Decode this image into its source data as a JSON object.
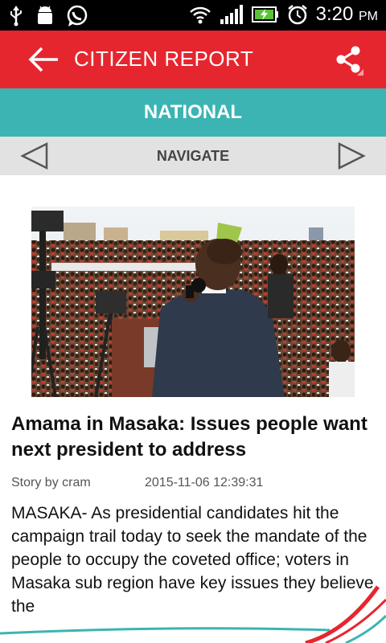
{
  "status_bar": {
    "time": "3:20",
    "ampm": "PM",
    "icons": [
      "usb-icon",
      "android-debug-icon",
      "whatsapp-icon",
      "wifi-icon",
      "signal-icon",
      "battery-icon",
      "alarm-icon"
    ]
  },
  "app_bar": {
    "title": "CITIZEN REPORT",
    "color": "#e6262f"
  },
  "section": {
    "title": "NATIONAL",
    "color": "#3cb4b3"
  },
  "navigation": {
    "label": "NAVIGATE"
  },
  "article": {
    "headline": "Amama in Masaka: Issues people want next president to address",
    "byline": "Story by cram",
    "date": "2015-11-06 12:39:31",
    "body": "MASAKA- As presidential candidates hit the campaign trail today to seek the mandate of the people to occupy the coveted office; voters in Masaka sub region have key issues they believe the"
  }
}
